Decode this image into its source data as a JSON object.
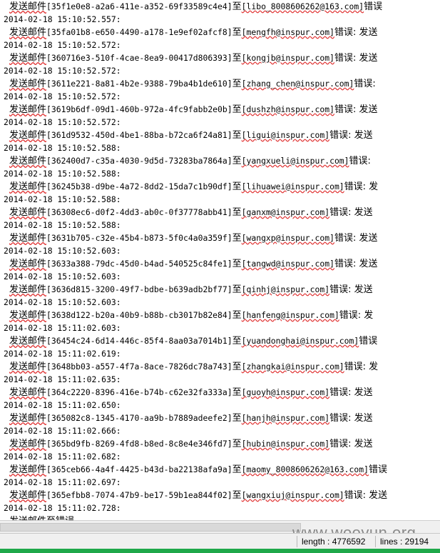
{
  "log": {
    "lines": [
      {
        "kind": "msg",
        "prefix": "发送邮件",
        "id": "[35f1e0e8-a2a6-411e-a352-69f33589c4e4]",
        "to": "至",
        "email": "[libo_8008606262@163.com]",
        "suffix": "错误"
      },
      {
        "kind": "ts",
        "text": "2014-02-18 15:10:52.557:"
      },
      {
        "kind": "msg",
        "prefix": "发送邮件",
        "id": "[35fa01b8-e650-4490-a178-1e9ef02afcf8]",
        "to": "至",
        "email": "[mengfh@inspur.com]",
        "suffix": "错误: 发送"
      },
      {
        "kind": "ts",
        "text": "2014-02-18 15:10:52.572:"
      },
      {
        "kind": "msg",
        "prefix": "发送邮件",
        "id": "[360716e3-510f-4cae-8ea9-00417d806393]",
        "to": "至",
        "email": "[kongjb@inspur.com]",
        "suffix": "错误: 发送"
      },
      {
        "kind": "ts",
        "text": "2014-02-18 15:10:52.572:"
      },
      {
        "kind": "msg",
        "prefix": "发送邮件",
        "id": "[3611e221-8a81-4b2e-9388-79ba4b1de610]",
        "to": "至",
        "email": "[zhang_chen@inspur.com]",
        "suffix": "错误:"
      },
      {
        "kind": "ts",
        "text": "2014-02-18 15:10:52.572:"
      },
      {
        "kind": "msg",
        "prefix": "发送邮件",
        "id": "[3619b6df-09d1-460b-972a-4fc9fabb2e0b]",
        "to": "至",
        "email": "[dushzh@inspur.com]",
        "suffix": "错误: 发送"
      },
      {
        "kind": "ts",
        "text": "2014-02-18 15:10:52.572:"
      },
      {
        "kind": "msg",
        "prefix": "发送邮件",
        "id": "[361d9532-450d-4be1-88ba-b72ca6f24a81]",
        "to": "至",
        "email": "[ligui@inspur.com]",
        "suffix": "错误: 发送"
      },
      {
        "kind": "ts",
        "text": "2014-02-18 15:10:52.588:"
      },
      {
        "kind": "msg",
        "prefix": "发送邮件",
        "id": "[362400d7-c35a-4030-9d5d-73283ba7864a]",
        "to": "至",
        "email": "[yangxueli@inspur.com]",
        "suffix": "错误:"
      },
      {
        "kind": "ts",
        "text": "2014-02-18 15:10:52.588:"
      },
      {
        "kind": "msg",
        "prefix": "发送邮件",
        "id": "[36245b38-d9be-4a72-8dd2-15da7c1b90df]",
        "to": "至",
        "email": "[lihuawei@inspur.com]",
        "suffix": "错误: 发"
      },
      {
        "kind": "ts",
        "text": "2014-02-18 15:10:52.588:"
      },
      {
        "kind": "msg",
        "prefix": "发送邮件",
        "id": "[36308ec6-d0f2-4dd3-ab0c-0f37778abb41]",
        "to": "至",
        "email": "[ganxm@inspur.com]",
        "suffix": "错误: 发送"
      },
      {
        "kind": "ts",
        "text": "2014-02-18 15:10:52.588:"
      },
      {
        "kind": "msg",
        "prefix": "发送邮件",
        "id": "[3631b705-c32e-45b4-b873-5f0c4a0a359f]",
        "to": "至",
        "email": "[wangxp@inspur.com]",
        "suffix": "错误: 发送"
      },
      {
        "kind": "ts",
        "text": "2014-02-18 15:10:52.603:"
      },
      {
        "kind": "msg",
        "prefix": "发送邮件",
        "id": "[3633a388-79dc-45d0-b4ad-540525c84fe1]",
        "to": "至",
        "email": "[tangwd@inspur.com]",
        "suffix": "错误: 发送"
      },
      {
        "kind": "ts",
        "text": "2014-02-18 15:10:52.603:"
      },
      {
        "kind": "msg",
        "prefix": "发送邮件",
        "id": "[3636d815-3200-49f7-bdbe-b639adb2bf77]",
        "to": "至",
        "email": "[qinhj@inspur.com]",
        "suffix": "错误: 发送"
      },
      {
        "kind": "ts",
        "text": "2014-02-18 15:10:52.603:"
      },
      {
        "kind": "msg",
        "prefix": "发送邮件",
        "id": "[3638d122-b20a-40b9-b88b-cb3017b82e84]",
        "to": "至",
        "email": "[hanfeng@inspur.com]",
        "suffix": "错误: 发"
      },
      {
        "kind": "ts",
        "text": "2014-02-18 15:11:02.603:"
      },
      {
        "kind": "msg",
        "prefix": "发送邮件",
        "id": "[36454c24-6d14-446c-85f4-8aa03a7014b1]",
        "to": "至",
        "email": "[yuandonghai@inspur.com]",
        "suffix": "错误"
      },
      {
        "kind": "ts",
        "text": "2014-02-18 15:11:02.619:"
      },
      {
        "kind": "msg",
        "prefix": "发送邮件",
        "id": "[3648bb03-a557-4f7a-8ace-7826dc78a743]",
        "to": "至",
        "email": "[zhangkai@inspur.com]",
        "suffix": "错误: 发"
      },
      {
        "kind": "ts",
        "text": "2014-02-18 15:11:02.635:"
      },
      {
        "kind": "msg",
        "prefix": "发送邮件",
        "id": "[364c2220-8396-416e-b74b-c62e32fa333a]",
        "to": "至",
        "email": "[guoyh@inspur.com]",
        "suffix": "错误: 发送"
      },
      {
        "kind": "ts",
        "text": "2014-02-18 15:11:02.650:"
      },
      {
        "kind": "msg",
        "prefix": "发送邮件",
        "id": "[365082c8-1345-4170-aa9b-b7889adeefe2]",
        "to": "至",
        "email": "[hanjh@inspur.com]",
        "suffix": "错误: 发送"
      },
      {
        "kind": "ts",
        "text": "2014-02-18 15:11:02.666:"
      },
      {
        "kind": "msg",
        "prefix": "发送邮件",
        "id": "[365bd9fb-8269-4fd8-b8ed-8c8e4e346fd7]",
        "to": "至",
        "email": "[hubin@inspur.com]",
        "suffix": "错误: 发送"
      },
      {
        "kind": "ts",
        "text": "2014-02-18 15:11:02.682:"
      },
      {
        "kind": "msg",
        "prefix": "发送邮件",
        "id": "[365ceb66-4a4f-4425-b43d-ba22138afa9a]",
        "to": "至",
        "email": "[maomy_8008606262@163.com]",
        "suffix": "错误"
      },
      {
        "kind": "ts",
        "text": "2014-02-18 15:11:02.697:"
      },
      {
        "kind": "msg",
        "prefix": "发送邮件",
        "id": "[365efbb8-7074-47b9-be17-59b1ea844f02]",
        "to": "至",
        "email": "[wangxiuj@inspur.com]",
        "suffix": "错误: 发送"
      },
      {
        "kind": "ts",
        "text": "2014-02-18 15:11:02.728:"
      },
      {
        "kind": "msg",
        "prefix": "发送邮件",
        "id": "",
        "to": "至",
        "email": "",
        "suffix": "错误"
      }
    ]
  },
  "statusbar": {
    "length": "length : 4776592",
    "lines": "lines : 29194"
  },
  "watermark": "www.wooyun.org",
  "colors": {
    "squiggle": "#e03030",
    "status_bg": "#f0f0f0",
    "bottom_strip": "#1fa84a"
  }
}
